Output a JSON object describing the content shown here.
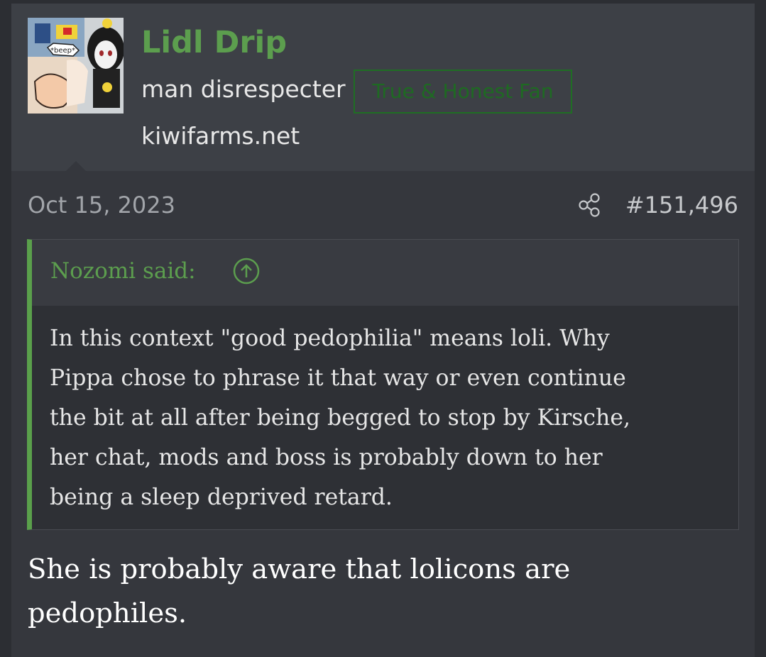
{
  "user": {
    "name": "Lidl Drip",
    "title": "man disrespecter",
    "banner": "True & Honest Fan",
    "site": "kiwifarms.net",
    "avatar_caption": "*beep*"
  },
  "post": {
    "date": "Oct 15, 2023",
    "number": "#151,496",
    "share_icon": "share-icon"
  },
  "quote": {
    "author": "Nozomi said:",
    "jump_icon": "arrow-up-circle-icon",
    "lines": [
      "In this context \"good pedophilia\" means loli. Why",
      "Pippa chose to phrase it that way or even continue",
      "the bit at all after being begged to stop by Kirsche,",
      "her chat, mods and boss is probably down to her",
      "being a sleep deprived retard."
    ]
  },
  "reply": {
    "lines": [
      "She is probably aware that lolicons are",
      "pedophiles."
    ]
  },
  "colors": {
    "accent_green": "#5c9e4e",
    "banner_green": "#1f6e24",
    "background": "#35373d"
  }
}
